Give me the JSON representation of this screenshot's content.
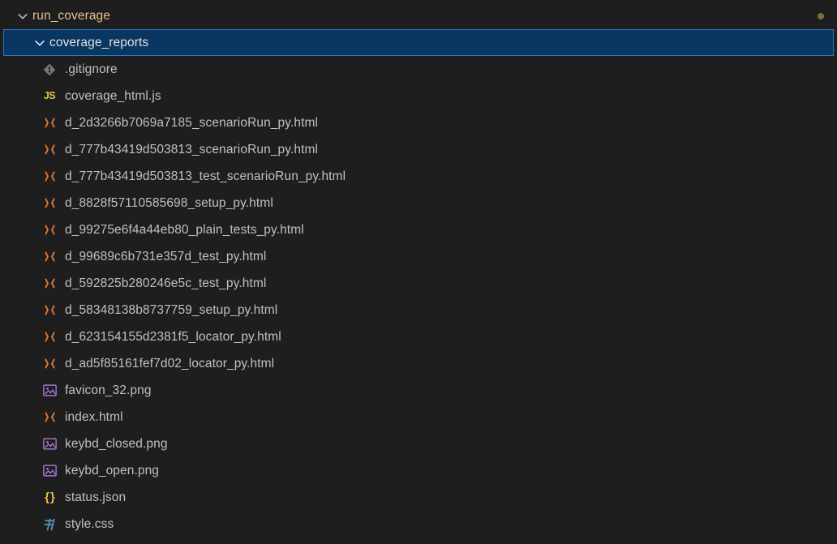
{
  "root": {
    "name": "run_coverage",
    "expanded": true,
    "dirty": true
  },
  "selected_folder": {
    "name": "coverage_reports",
    "expanded": true
  },
  "items": [
    {
      "icon": "git",
      "name": ".gitignore"
    },
    {
      "icon": "js",
      "name": "coverage_html.js"
    },
    {
      "icon": "html",
      "name": "d_2d3266b7069a7185_scenarioRun_py.html"
    },
    {
      "icon": "html",
      "name": "d_777b43419d503813_scenarioRun_py.html"
    },
    {
      "icon": "html",
      "name": "d_777b43419d503813_test_scenarioRun_py.html"
    },
    {
      "icon": "html",
      "name": "d_8828f57110585698_setup_py.html"
    },
    {
      "icon": "html",
      "name": "d_99275e6f4a44eb80_plain_tests_py.html"
    },
    {
      "icon": "html",
      "name": "d_99689c6b731e357d_test_py.html"
    },
    {
      "icon": "html",
      "name": "d_592825b280246e5c_test_py.html"
    },
    {
      "icon": "html",
      "name": "d_58348138b8737759_setup_py.html"
    },
    {
      "icon": "html",
      "name": "d_623154155d2381f5_locator_py.html"
    },
    {
      "icon": "html",
      "name": "d_ad5f85161fef7d02_locator_py.html"
    },
    {
      "icon": "img",
      "name": "favicon_32.png"
    },
    {
      "icon": "html",
      "name": "index.html"
    },
    {
      "icon": "img",
      "name": "keybd_closed.png"
    },
    {
      "icon": "img",
      "name": "keybd_open.png"
    },
    {
      "icon": "json",
      "name": "status.json"
    },
    {
      "icon": "css",
      "name": "style.css"
    }
  ],
  "colors": {
    "folder_root": "#e2c08d",
    "selected_bg": "#0a3761",
    "selected_border": "#3377c4",
    "html": "#e37933",
    "js": "#e6c14c",
    "git": "#8a8a8a",
    "img": "#a074c4",
    "json": "#e6c14c",
    "css": "#519aba"
  }
}
